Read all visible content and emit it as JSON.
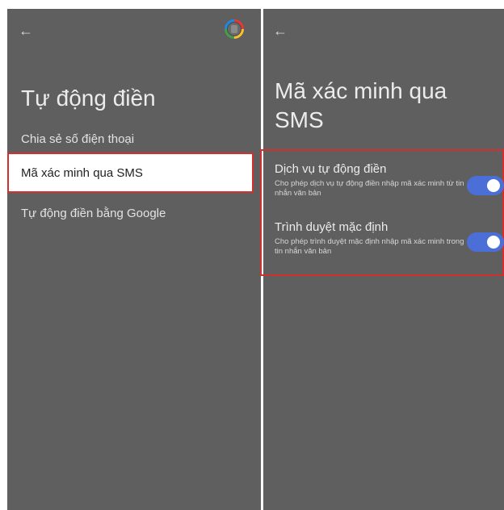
{
  "left_screen": {
    "title": "Tự động điền",
    "menu": [
      {
        "label": "Chia sẻ số điện thoại"
      },
      {
        "label": "Mã xác minh qua SMS"
      },
      {
        "label": "Tự động điền bằng Google"
      }
    ],
    "back_glyph": "←"
  },
  "right_screen": {
    "title": "Mã xác minh qua SMS",
    "back_glyph": "←",
    "settings": [
      {
        "title": "Dịch vụ tự động điền",
        "description": "Cho phép dịch vụ tự động điền nhập mã xác minh từ tin nhắn văn bản",
        "enabled": true
      },
      {
        "title": "Trình duyệt mặc định",
        "description": "Cho phép trình duyệt mặc định nhập mã xác minh trong tin nhắn văn bản",
        "enabled": true
      }
    ]
  },
  "colors": {
    "background": "#5f5f5f",
    "highlight_border": "#d32f2f",
    "toggle_on": "#4b6fd6"
  },
  "icons": [
    "back-arrow-icon",
    "account-avatar-icon"
  ]
}
